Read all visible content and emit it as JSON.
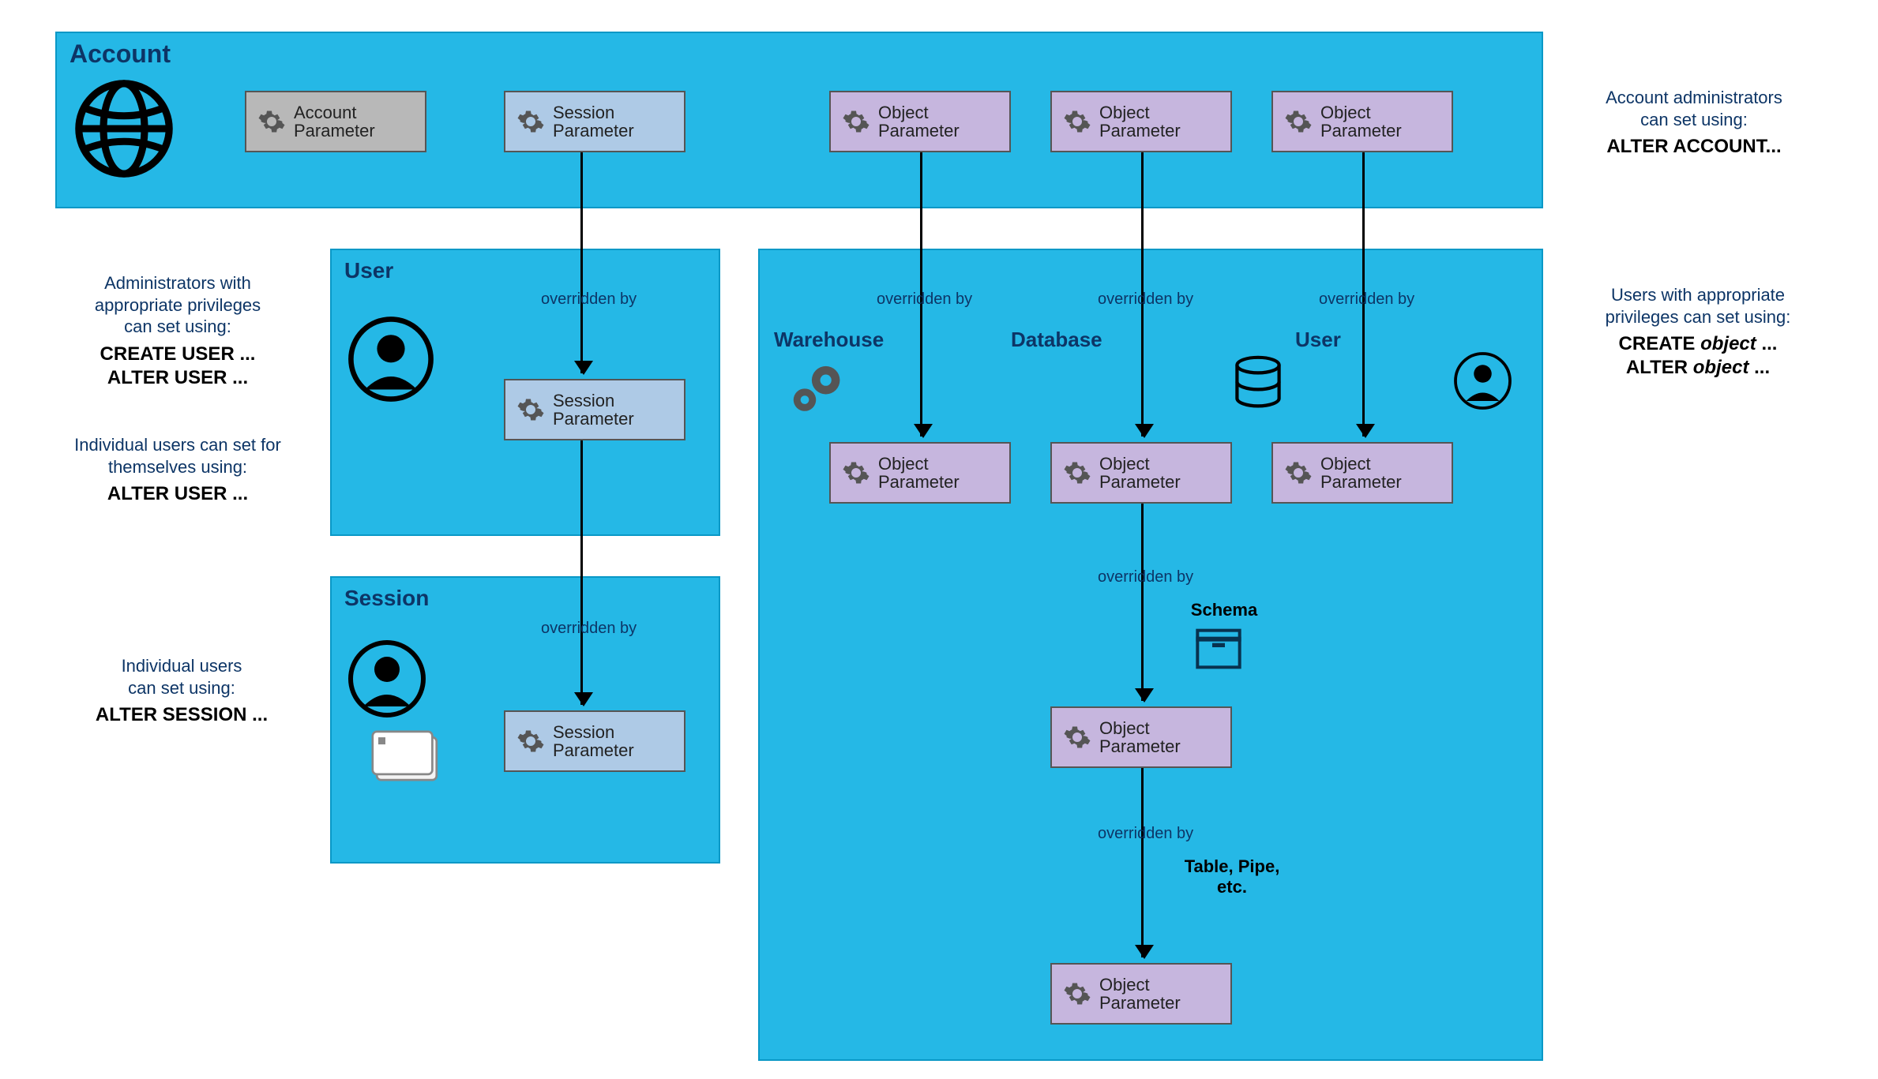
{
  "panels": {
    "account": "Account",
    "user": "User",
    "session": "Session",
    "warehouse": "Warehouse",
    "database": "Database",
    "userObj": "User",
    "schema": "Schema",
    "table": "Table, Pipe,\netc."
  },
  "params": {
    "account": "Account\nParameter",
    "session": "Session\nParameter",
    "object": "Object\nParameter"
  },
  "overridden": "overridden by",
  "side": {
    "acct": {
      "t": "Account administrators\ncan set using:",
      "c": "ALTER ACCOUNT..."
    },
    "admin": {
      "t": "Administrators with\nappropriate privileges\ncan set using:",
      "c": "CREATE USER ...\nALTER USER ..."
    },
    "indivUser": {
      "t": "Individual users can set for\nthemselves using:",
      "c": "ALTER USER ..."
    },
    "indivSess": {
      "t": "Individual users\ncan set using:",
      "c": "ALTER SESSION ..."
    },
    "obj": {
      "t": "Users with appropriate\nprivileges can set using:",
      "c1": "CREATE object ...",
      "c2": "ALTER object ..."
    }
  }
}
